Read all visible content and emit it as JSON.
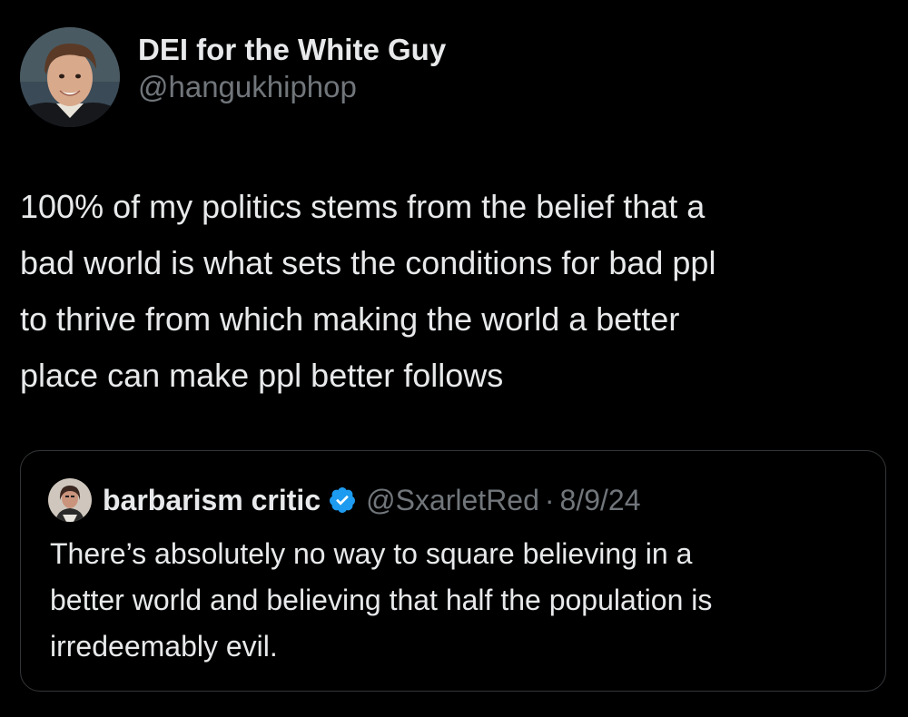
{
  "tweet": {
    "author": {
      "display_name": "DEI for the White Guy",
      "handle": "@hangukhiphop",
      "avatar_icon": "profile-photo"
    },
    "text": "100% of my politics stems from the belief that a\nbad world is what sets the conditions for bad ppl\nto thrive from which making the world a better\nplace can make ppl better follows"
  },
  "quote": {
    "author": {
      "display_name": "barbarism critic",
      "handle": "@SxarletRed",
      "separator": "·",
      "date": "8/9/24",
      "verified": true,
      "verified_icon": "verified-badge-icon",
      "avatar_icon": "profile-photo"
    },
    "text": "There’s absolutely no way to square believing in a\nbetter world and believing that half the population is\nirredeemably evil."
  },
  "colors": {
    "background": "#000000",
    "primary_text": "#e7e9ea",
    "secondary_text": "#71767b",
    "border": "#333639",
    "verified_blue": "#1d9bf0"
  }
}
